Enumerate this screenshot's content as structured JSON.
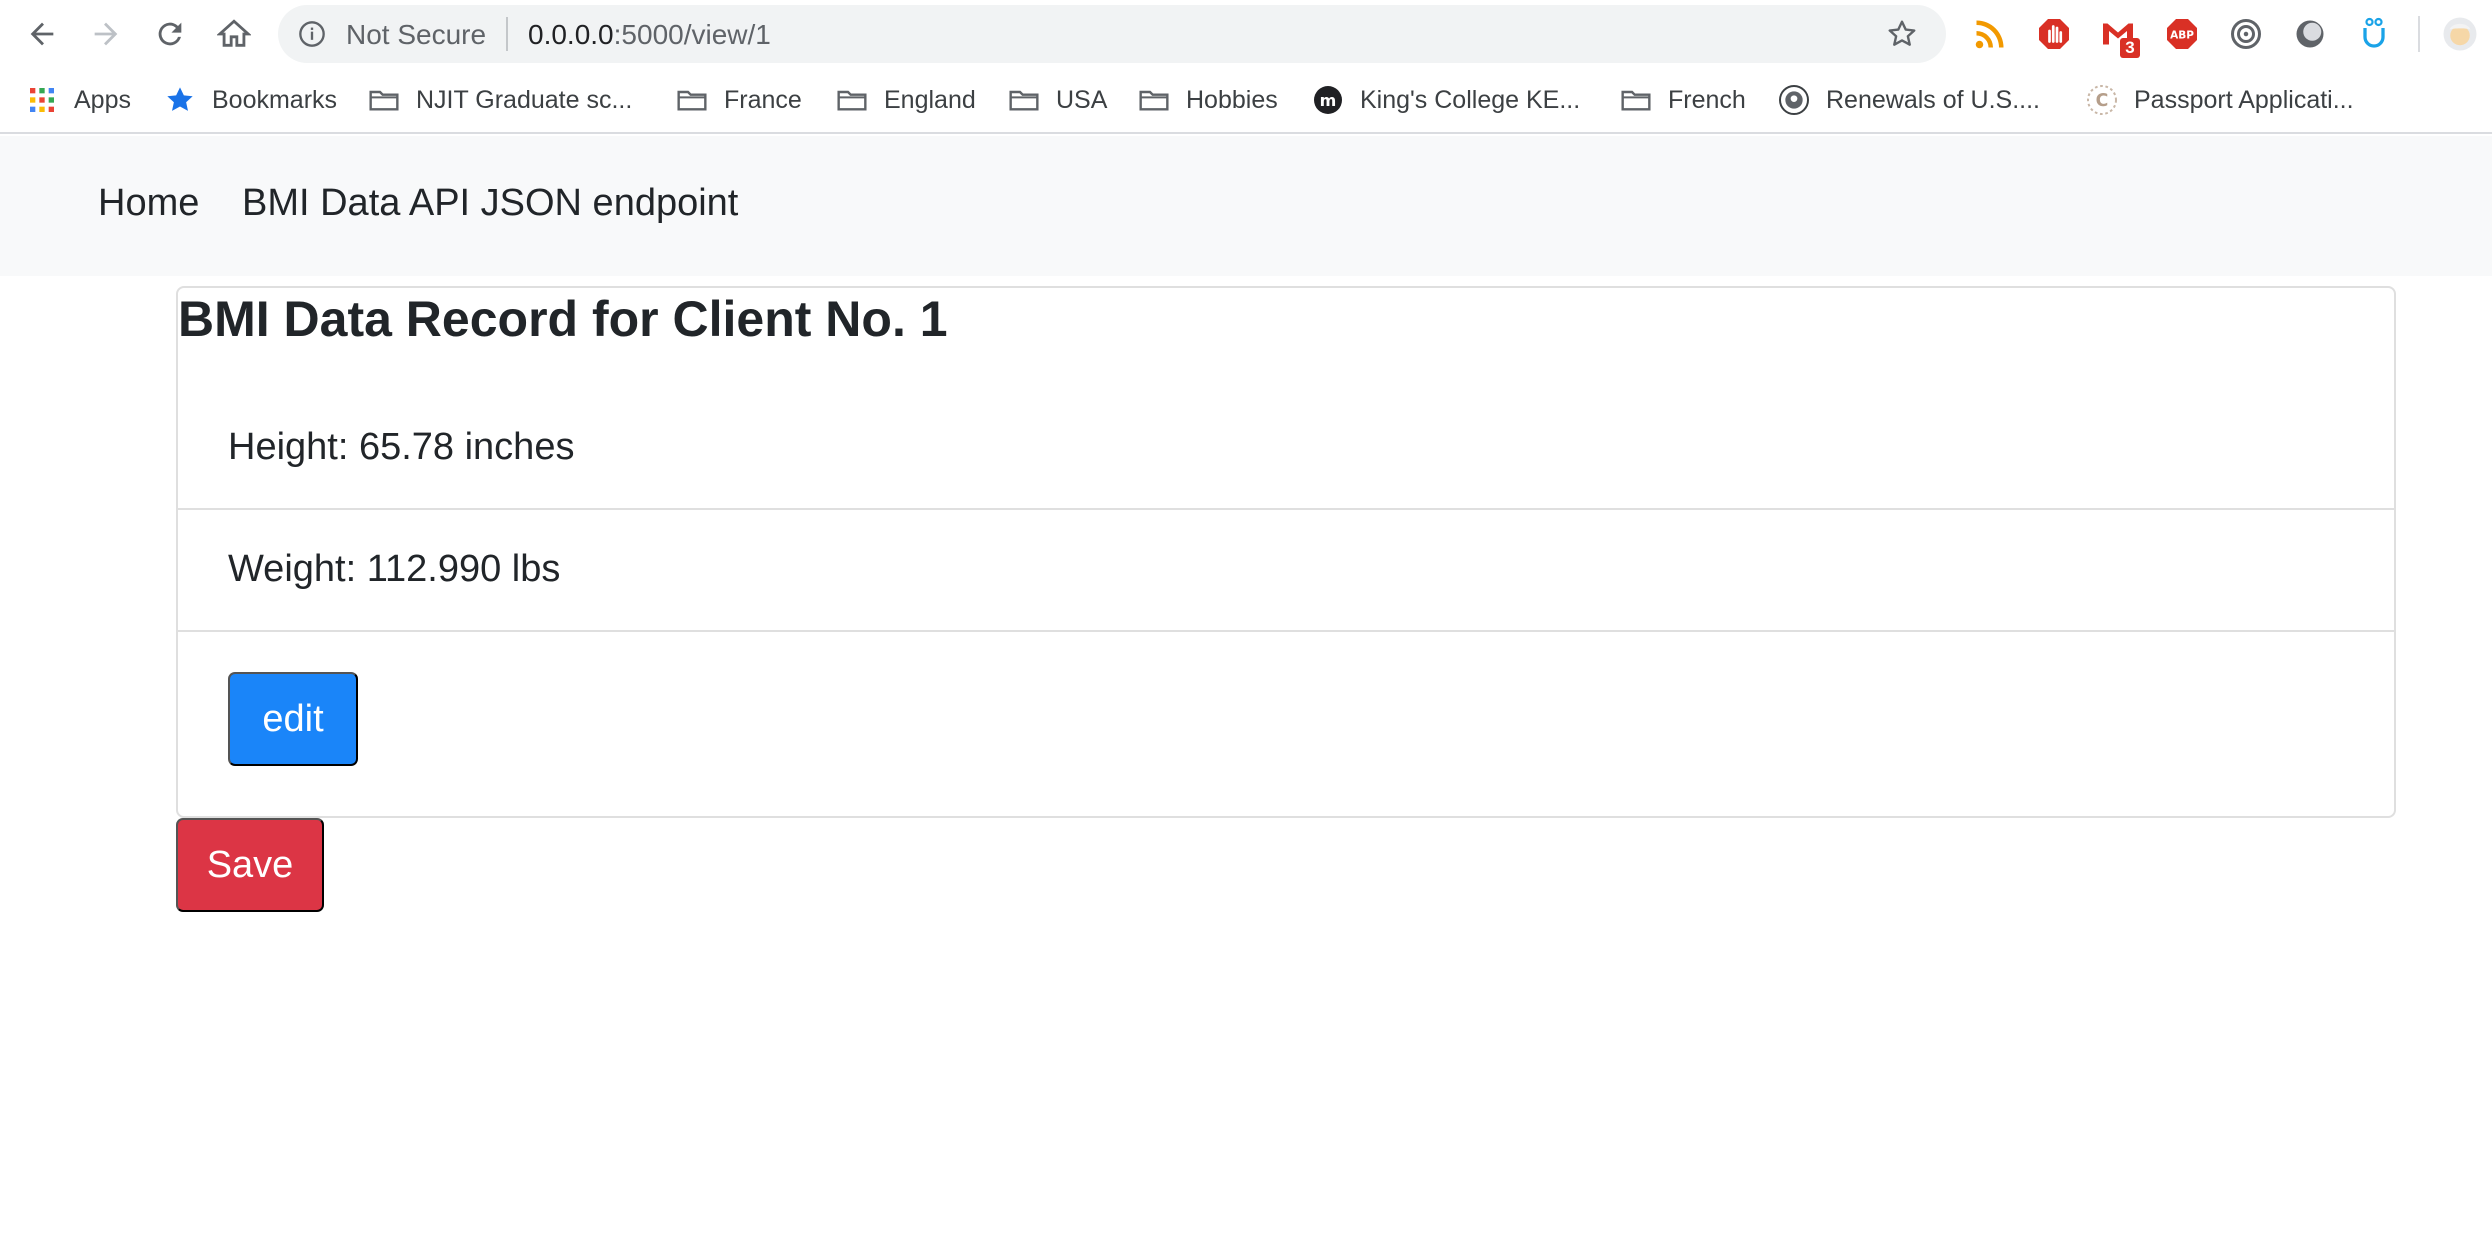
{
  "browser": {
    "security_label": "Not Secure",
    "url_host": "0.0.0.0",
    "url_path": ":5000/view/1",
    "extension_badge": "3"
  },
  "bookmarks": {
    "apps": "Apps",
    "bookmarks": "Bookmarks",
    "njit": "NJIT Graduate sc...",
    "france": "France",
    "england": "England",
    "usa": "USA",
    "hobbies": "Hobbies",
    "kings": "King's College KE...",
    "french": "French",
    "renewals": "Renewals of U.S....",
    "passport": "Passport Applicati..."
  },
  "navbar": {
    "home": "Home",
    "api": "BMI Data API JSON endpoint"
  },
  "record": {
    "title": "BMI Data Record for Client No. 1",
    "height": "Height: 65.78 inches",
    "weight": "Weight: 112.990 lbs",
    "edit_label": "edit",
    "save_label": "Save"
  },
  "colors": {
    "primary": "#1a85f9",
    "danger": "#dc3545",
    "navbar_bg": "#f8f9fa"
  }
}
